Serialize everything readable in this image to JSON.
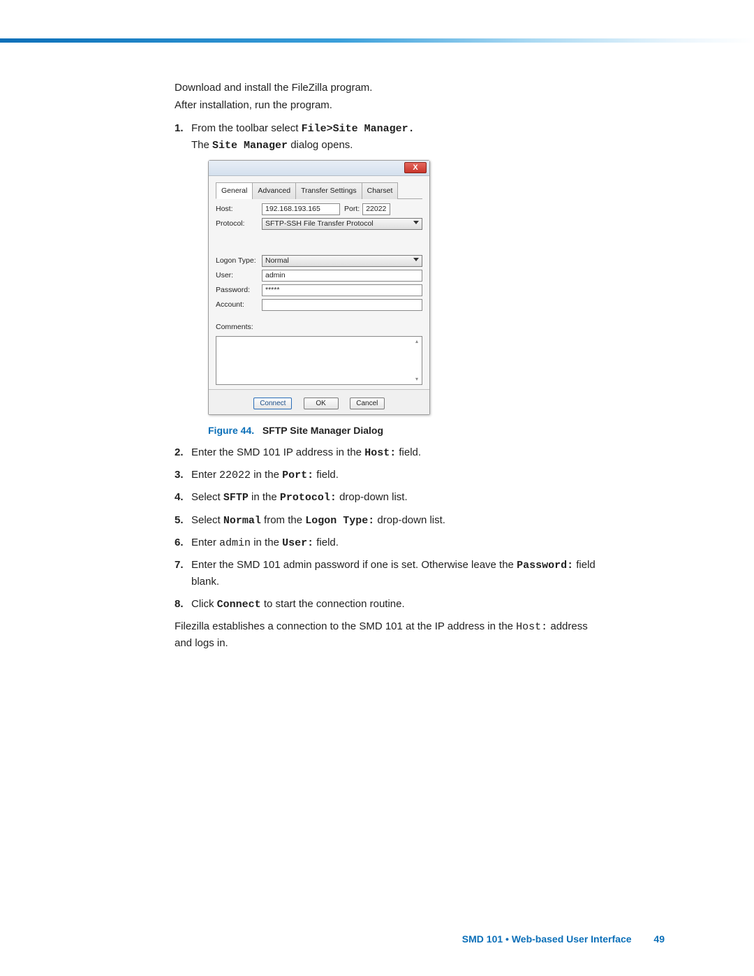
{
  "intro": {
    "line1": "Download and install the FileZilla program.",
    "line2": "After installation, run the program."
  },
  "step1": {
    "num": "1.",
    "pre": "From the toolbar select ",
    "mono": "File>Site Manager.",
    "post1": "The ",
    "mono2": "Site Manager",
    "post2": " dialog opens."
  },
  "dialog": {
    "close_x": "X",
    "tabs": {
      "general": "General",
      "advanced": "Advanced",
      "transfer": "Transfer Settings",
      "charset": "Charset"
    },
    "labels": {
      "host": "Host:",
      "port": "Port:",
      "protocol": "Protocol:",
      "logon": "Logon Type:",
      "user": "User:",
      "password": "Password:",
      "account": "Account:",
      "comments": "Comments:"
    },
    "values": {
      "host": "192.168.193.165",
      "port": "22022",
      "protocol": "SFTP-SSH File Transfer Protocol",
      "logon": "Normal",
      "user": "admin",
      "password": "*****",
      "account": ""
    },
    "buttons": {
      "connect": "Connect",
      "ok": "OK",
      "cancel": "Cancel"
    }
  },
  "figure": {
    "label": "Figure 44.",
    "title": "SFTP Site Manager Dialog"
  },
  "step2": {
    "num": "2.",
    "pre": "Enter the SMD 101 IP address in the ",
    "mono": "Host:",
    "post": " field."
  },
  "step3": {
    "num": "3.",
    "pre": "Enter ",
    "mono1": "22022",
    "mid": " in the ",
    "mono2": "Port:",
    "post": " field."
  },
  "step4": {
    "num": "4.",
    "pre": "Select ",
    "mono1": "SFTP",
    "mid": " in the ",
    "mono2": "Protocol:",
    "post": " drop-down list."
  },
  "step5": {
    "num": "5.",
    "pre": "Select ",
    "mono1": "Normal",
    "mid": " from the ",
    "mono2": "Logon Type:",
    "post": " drop-down list."
  },
  "step6": {
    "num": "6.",
    "pre": "Enter ",
    "mono1": "admin",
    "mid": " in the ",
    "mono2": "User:",
    "post": " field."
  },
  "step7": {
    "num": "7.",
    "pre": "Enter the SMD 101 admin password if one is set. Otherwise leave the ",
    "mono": "Password:",
    "post": " field blank."
  },
  "step8": {
    "num": "8.",
    "pre": "Click ",
    "mono": "Connect",
    "post": " to start the connection routine."
  },
  "closing": {
    "pre": "Filezilla establishes a connection to the SMD 101 at the IP address in the ",
    "mono": "Host:",
    "post": " address and logs in."
  },
  "footer": {
    "text": "SMD 101 • Web-based User Interface",
    "page": "49"
  }
}
